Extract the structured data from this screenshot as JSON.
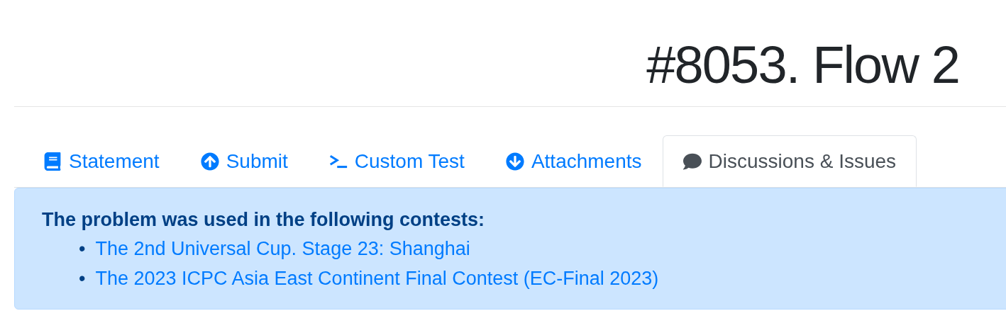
{
  "title": "#8053. Flow 2",
  "tabs": [
    {
      "label": "Statement",
      "selected": false
    },
    {
      "label": "Submit",
      "selected": false
    },
    {
      "label": "Custom Test",
      "selected": false
    },
    {
      "label": "Attachments",
      "selected": false
    },
    {
      "label": "Discussions & Issues",
      "selected": true
    }
  ],
  "alert": {
    "heading": "The problem was used in the following contests:",
    "contests": [
      {
        "marker": "•",
        "text": "The 2nd Universal Cup. Stage 23: Shanghai"
      },
      {
        "marker": "•",
        "text": "The 2023 ICPC Asia East Continent Final Contest (EC-Final 2023)"
      }
    ]
  }
}
